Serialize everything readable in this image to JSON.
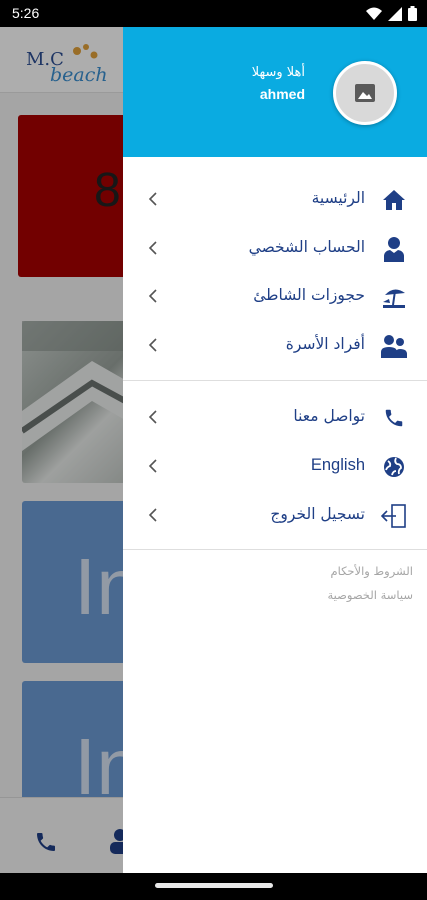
{
  "status_bar": {
    "time": "5:26",
    "icons": [
      "wifi-icon",
      "signal-icon",
      "battery-icon"
    ]
  },
  "background_app": {
    "logo_text_top": "M.C",
    "logo_text_bottom": "beach",
    "red_card_text": "8",
    "blue_card_text": "In"
  },
  "drawer": {
    "greeting": "أهلا وسهلا",
    "user_name": "ahmed",
    "avatar_icon": "image-placeholder-icon",
    "accent_color": "#0aabe1",
    "text_color": "#1f3f86",
    "menu_primary": [
      {
        "label": "الرئيسية",
        "icon": "home-icon"
      },
      {
        "label": "الحساب الشخصي",
        "icon": "user-icon"
      },
      {
        "label": "حجوزات الشاطئ",
        "icon": "beach-umbrella-icon"
      },
      {
        "label": "أفراد الأسرة",
        "icon": "family-icon"
      }
    ],
    "menu_secondary": [
      {
        "label": "تواصل معنا",
        "icon": "phone-icon"
      },
      {
        "label": "English",
        "icon": "globe-icon"
      },
      {
        "label": "تسجيل الخروج",
        "icon": "logout-icon"
      }
    ],
    "footer_links": [
      "الشروط والأحكام",
      "سياسة الخصوصية"
    ]
  }
}
